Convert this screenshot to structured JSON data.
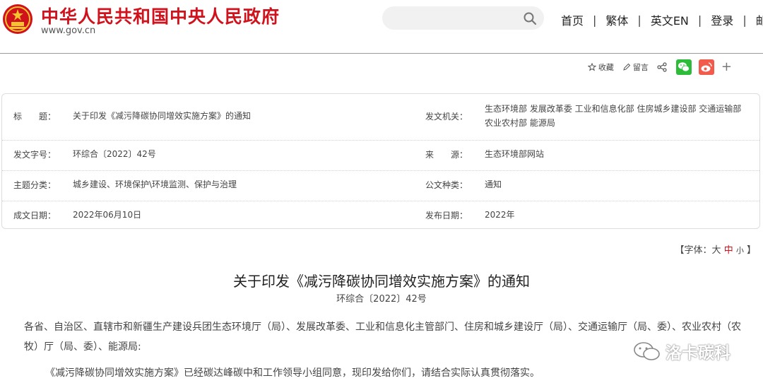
{
  "header": {
    "site_title": "中华人民共和国中央人民政府",
    "site_url": "www.gov.cn",
    "nav": [
      "首页",
      "繁体",
      "英文EN",
      "登录",
      "邮箱"
    ],
    "nav_sep": "|"
  },
  "tools": {
    "favorite_label": "收藏",
    "comment_label": "留言",
    "more_label": "+"
  },
  "info": {
    "title_label": "标　　题：",
    "title_value": "关于印发《减污降碳协同增效实施方案》的通知",
    "issuer_label": "发文机关：",
    "issuer_value": "生态环境部 发展改革委 工业和信息化部 住房城乡建设部 交通运输部 农业农村部 能源局",
    "docno_label": "发文字号：",
    "docno_value": "环综合〔2022〕42号",
    "source_label": "来　　源：",
    "source_value": "生态环境部网站",
    "topic_label": "主题分类：",
    "topic_value": "城乡建设、环境保护\\环境监测、保护与治理",
    "type_label": "公文种类：",
    "type_value": "通知",
    "date_label": "成文日期：",
    "date_value": "2022年06月10日",
    "pub_label": "发布日期：",
    "pub_value": "2022年"
  },
  "font_size": {
    "prefix": "【字体：",
    "large": "大",
    "medium": "中",
    "small": "小",
    "suffix": "】"
  },
  "article": {
    "title": "关于印发《减污降碳协同增效实施方案》的通知",
    "number": "环综合〔2022〕42号",
    "p1": "各省、自治区、直辖市和新疆生产建设兵团生态环境厅（局）、发展改革委、工业和信息化主管部门、住房和城乡建设厅（局）、交通运输厅（局、委）、农业农村（农牧）厅（局、委）、能源局:",
    "p2": "《减污降碳协同增效实施方案》已经碳达峰碳中和工作领导小组同意，现印发给你们，请结合实际认真贯彻落实。"
  },
  "watermark": "洛卡碳科",
  "colors": {
    "brand_red": "#d0121c",
    "wechat_green": "#2dbb3a",
    "weibo_red": "#f25a4c"
  }
}
